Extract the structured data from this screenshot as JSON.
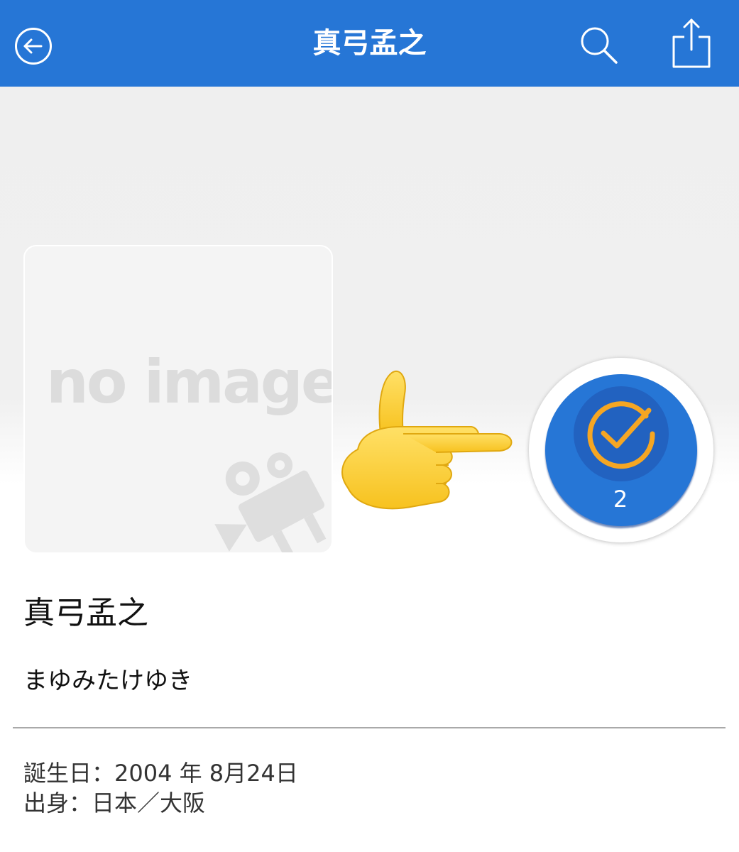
{
  "colors": {
    "header_bg": "#2676d6",
    "badge_bg": "#2676d6",
    "check_color": "#f5a623",
    "text_primary": "#111111"
  },
  "header": {
    "title": "真弓孟之",
    "back_icon": "back-arrow-circle-icon",
    "search_icon": "search-icon",
    "share_icon": "share-icon"
  },
  "profile": {
    "image_placeholder": "no image",
    "badge": {
      "icon": "check-circle-icon",
      "count": "2"
    },
    "name": "真弓孟之",
    "kana": "まゆみたけゆき",
    "birthday": "誕生日：2004 年 8月24日",
    "origin": "出身：日本／大阪"
  }
}
